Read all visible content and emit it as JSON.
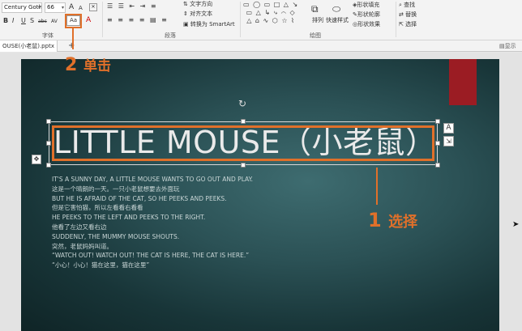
{
  "ribbon": {
    "font_name": "Century Goth",
    "font_size": "66",
    "grow_font": "A",
    "shrink_font": "A",
    "bold": "B",
    "italic": "I",
    "underline": "U",
    "shadow": "S",
    "strikethrough": "abc",
    "spacing": "AV",
    "change_case": "Aa",
    "font_color": "A",
    "font_group_label": "字体",
    "paragraph_group_label": "段落",
    "text_direction": "文字方向",
    "align_text": "对齐文本",
    "convert_smartart": "转换为 SmartArt",
    "drawing_group_label": "绘图",
    "arrange": "排列",
    "quick_styles": "快速样式",
    "shape_fill": "形状填充",
    "shape_outline": "形状轮廓",
    "shape_effects": "形状效果",
    "find": "查找",
    "replace": "替换",
    "select": "选择"
  },
  "tabs": {
    "file_tab": "OUSE(小老鼠).pptx",
    "add_tab": "+",
    "display_label": "显示"
  },
  "slide": {
    "title": "LITTLE MOUSE（小老鼠）",
    "body_lines": [
      "IT'S A SUNNY DAY, A LITTLE MOUSE WANTS TO GO OUT AND PLAY.",
      "这是一个晴朗的一天。一只小老鼠想要去外面玩",
      "BUT HE IS AFRAID OF THE CAT, SO HE PEEKS AND PEEKS.",
      "但是它害怕猫，所以左看看右看看",
      "HE PEEKS TO THE LEFT AND PEEKS TO THE RIGHT.",
      "他看了左边又看右边",
      "SUDDENLY, THE MUMMY MOUSE SHOUTS.",
      "突然，老鼠妈妈叫道。",
      "“WATCH OUT! WATCH OUT! THE CAT IS HERE, THE CAT IS HERE.”",
      "“小心！小心！猫在这里，猫在这里”"
    ]
  },
  "callouts": {
    "step2_num": "2",
    "step2_text": "单击",
    "step1_num": "1",
    "step1_text": "选择"
  },
  "side_icons": {
    "a_icon": "A",
    "resize_icon": "⇲",
    "layout_icon": "✥"
  }
}
